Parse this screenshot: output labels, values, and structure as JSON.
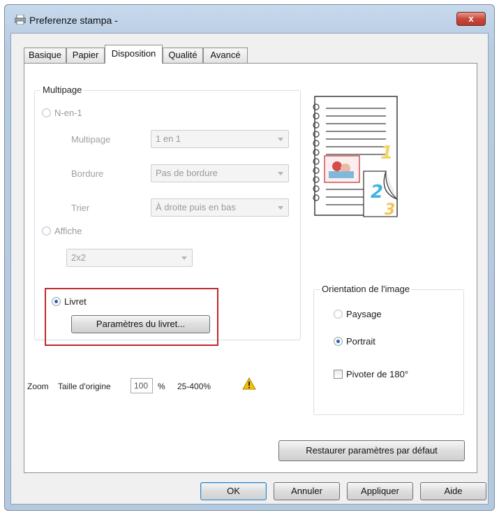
{
  "window": {
    "title": "Preferenze stampa -",
    "close_label": "x"
  },
  "tabs": [
    {
      "label": "Basique"
    },
    {
      "label": "Papier"
    },
    {
      "label": "Disposition"
    },
    {
      "label": "Qualité"
    },
    {
      "label": "Avancé"
    }
  ],
  "active_tab": "Disposition",
  "multipage": {
    "title": "Multipage",
    "n_en_1": {
      "label": "N-en-1",
      "selected": false,
      "enabled": false
    },
    "multipage_label": "Multipage",
    "multipage_value": "1 en 1",
    "bordure_label": "Bordure",
    "bordure_value": "Pas de bordure",
    "trier_label": "Trier",
    "trier_value": "À droite puis en bas",
    "affiche": {
      "label": "Affiche",
      "selected": false,
      "enabled": false
    },
    "affiche_value": "2x2",
    "livret": {
      "label": "Livret",
      "selected": true
    },
    "livret_button": "Paramètres du livret..."
  },
  "orientation": {
    "title": "Orientation de l'image",
    "paysage": {
      "label": "Paysage",
      "selected": false
    },
    "portrait": {
      "label": "Portrait",
      "selected": true
    },
    "pivoter": {
      "label": "Pivoter de 180°",
      "checked": false
    }
  },
  "zoom": {
    "label": "Zoom",
    "taille_label": "Taille d'origine",
    "value": "100",
    "unit": "%",
    "range": "25-400%"
  },
  "restore_button": "Restaurer paramètres par défaut",
  "footer": {
    "ok": "OK",
    "cancel": "Annuler",
    "apply": "Appliquer",
    "help": "Aide"
  },
  "preview": {
    "page_numbers": [
      "1",
      "2",
      "3"
    ]
  },
  "icons": {
    "printer": "printer-icon",
    "warning": "warning-icon",
    "close": "close-icon"
  },
  "colors": {
    "highlight": "#c0282b",
    "radio_selected": "#2e5fb0",
    "warning": "#f2c200"
  }
}
